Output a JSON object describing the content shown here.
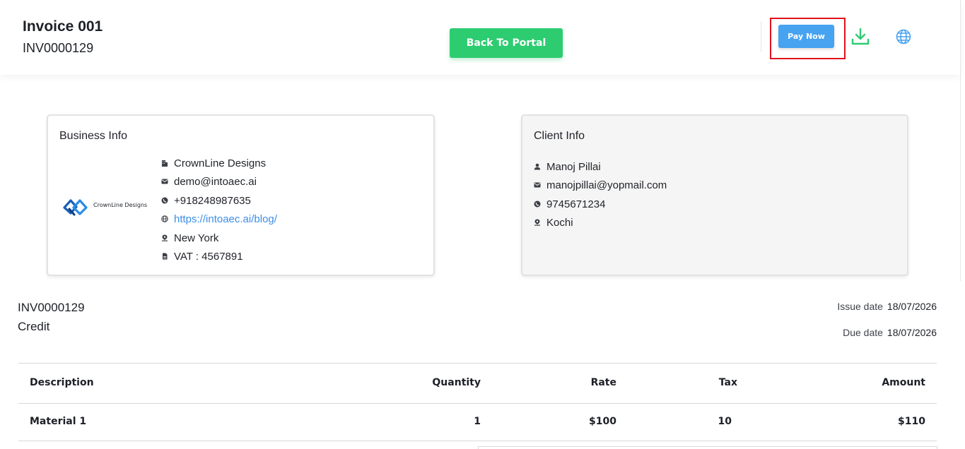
{
  "header": {
    "title": "Invoice 001",
    "invoice_number": "INV0000129",
    "back_button": "Back To Portal",
    "pay_button": "Pay Now",
    "icons": [
      "download-icon",
      "globe-icon"
    ],
    "colors": {
      "back_button": "#2ecc71",
      "pay_button": "#47a2f0",
      "highlight": "#e0121a"
    }
  },
  "business": {
    "title": "Business Info",
    "logo_text": "CrownLine Designs",
    "name": "CrownLine Designs",
    "email": "demo@intoaec.ai",
    "phone": "+918248987635",
    "website": "https://intoaec.ai/blog/",
    "location": "New York",
    "vat": "VAT : 4567891"
  },
  "client": {
    "title": "Client Info",
    "name": "Manoj Pillai",
    "email": "manojpillai@yopmail.com",
    "phone": "9745671234",
    "location": "Kochi"
  },
  "summary": {
    "number": "INV0000129",
    "type": "Credit",
    "issue_label": "Issue date",
    "issue_date": "18/07/2026",
    "due_label": "Due date",
    "due_date": "18/07/2026"
  },
  "table": {
    "headers": [
      "Description",
      "Quantity",
      "Rate",
      "Tax",
      "Amount"
    ],
    "rows": [
      [
        "Material 1",
        "1",
        "$100",
        "10",
        "$110"
      ]
    ]
  }
}
